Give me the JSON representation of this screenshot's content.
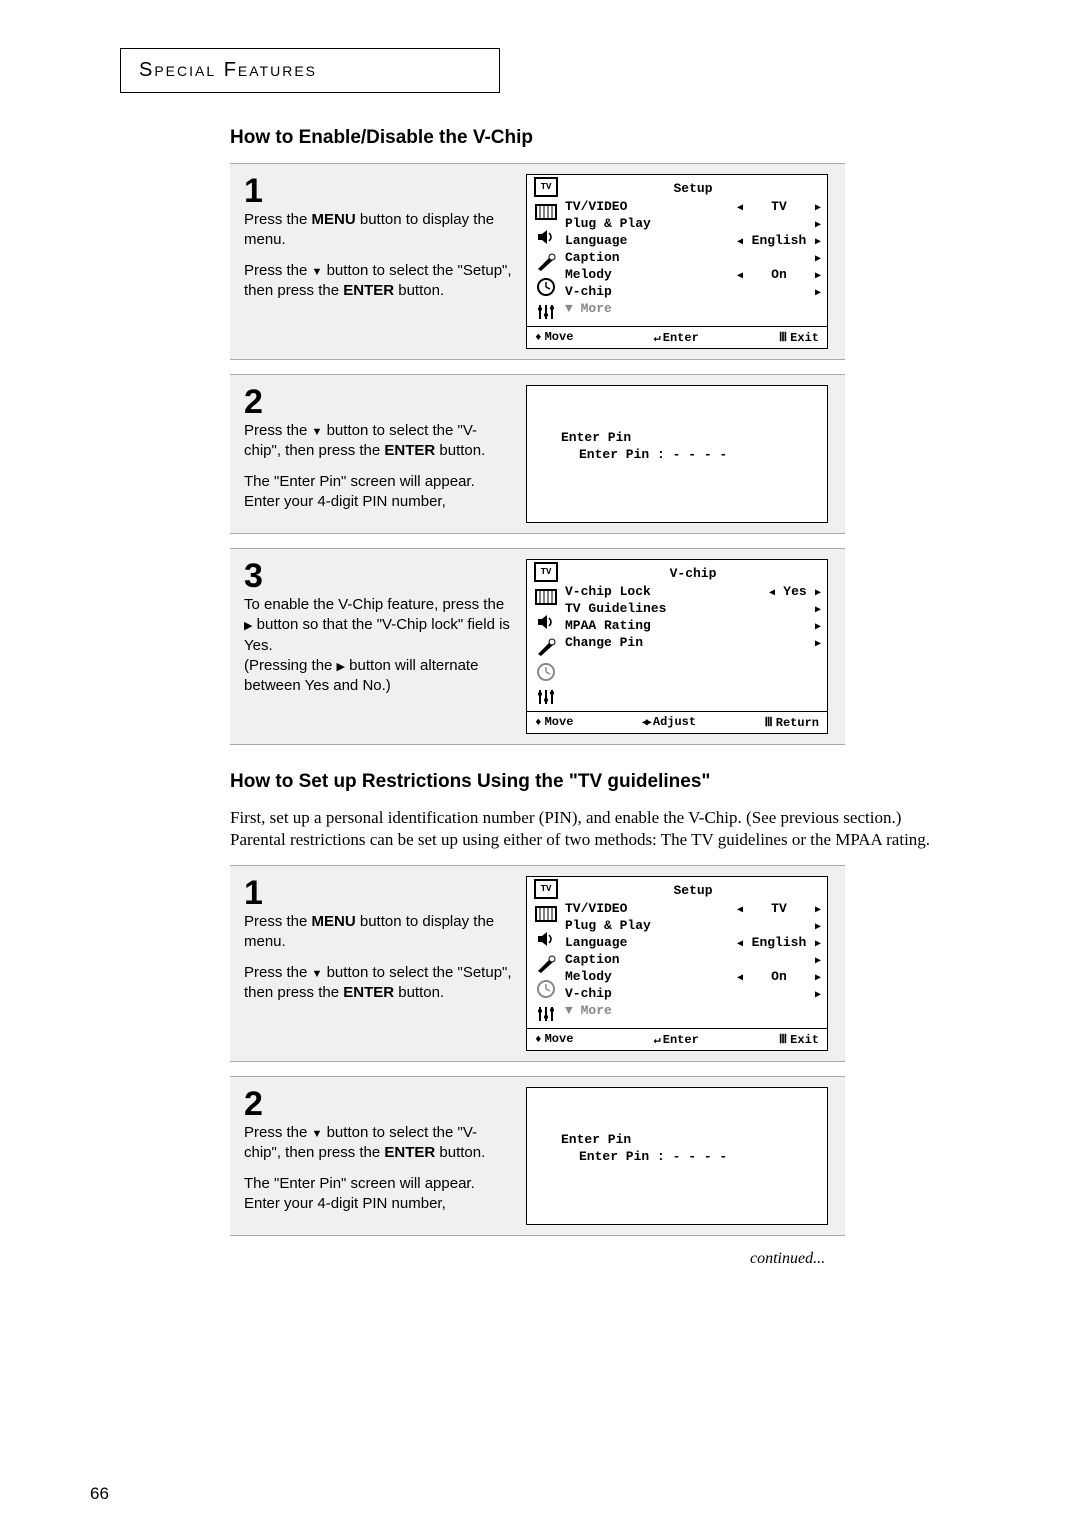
{
  "header": "Special Features",
  "section1_title": "How to Enable/Disable the V-Chip",
  "step1": {
    "num": "1",
    "text1a": "Press the ",
    "text1b": "MENU",
    "text1c": " button to display the menu.",
    "text2a": "Press the ",
    "text2b": " button to select the \"Setup\", then press the ",
    "text2c": "ENTER",
    "text2d": " button.",
    "osd": {
      "title": "Setup",
      "items": [
        {
          "label": "TV/VIDEO",
          "left": true,
          "val": "TV",
          "right": true
        },
        {
          "label": "Plug & Play",
          "left": false,
          "val": "",
          "right": true
        },
        {
          "label": "Language",
          "left": true,
          "val": "English",
          "right": true
        },
        {
          "label": "Caption",
          "left": false,
          "val": "",
          "right": true
        },
        {
          "label": "Melody",
          "left": true,
          "val": "On",
          "right": true
        },
        {
          "label": "V-chip",
          "left": false,
          "val": "",
          "right": true
        }
      ],
      "more": "▼ More",
      "footer": {
        "move": "Move",
        "enter": "Enter",
        "exit": "Exit"
      }
    }
  },
  "step2": {
    "num": "2",
    "text1a": "Press the ",
    "text1b": " button to select  the \"V-chip\", then press the ",
    "text1c": "ENTER",
    "text1d": " button.",
    "text2": "The \"Enter Pin\" screen will appear. Enter your 4-digit PIN number,",
    "osd": {
      "title": "Enter Pin",
      "sub": "Enter Pin   : - - - -"
    }
  },
  "step3": {
    "num": "3",
    "text1a": "To enable the V-Chip feature, press the ",
    "text1b": " button so that the \"V-Chip lock\" field is Yes.",
    "text2a": "(Pressing the ",
    "text2b": " button will alternate between Yes and No.)",
    "osd": {
      "title": "V-chip",
      "items": [
        {
          "label": "V-chip Lock",
          "left": true,
          "val": "Yes",
          "right": true
        },
        {
          "label": "TV Guidelines",
          "left": false,
          "val": "",
          "right": true
        },
        {
          "label": "MPAA Rating",
          "left": false,
          "val": "",
          "right": true
        },
        {
          "label": "Change Pin",
          "left": false,
          "val": "",
          "right": true
        }
      ],
      "footer": {
        "move": "Move",
        "adjust": "Adjust",
        "return": "Return"
      }
    }
  },
  "section2_title": "How to Set up Restrictions Using the \"TV guidelines\"",
  "para": "First, set up a personal identification number (PIN), and enable the V-Chip. (See previous section.)  Parental restrictions can be set up using either of two methods: The TV guidelines or the MPAA rating.",
  "continued": "continued...",
  "page": "66"
}
